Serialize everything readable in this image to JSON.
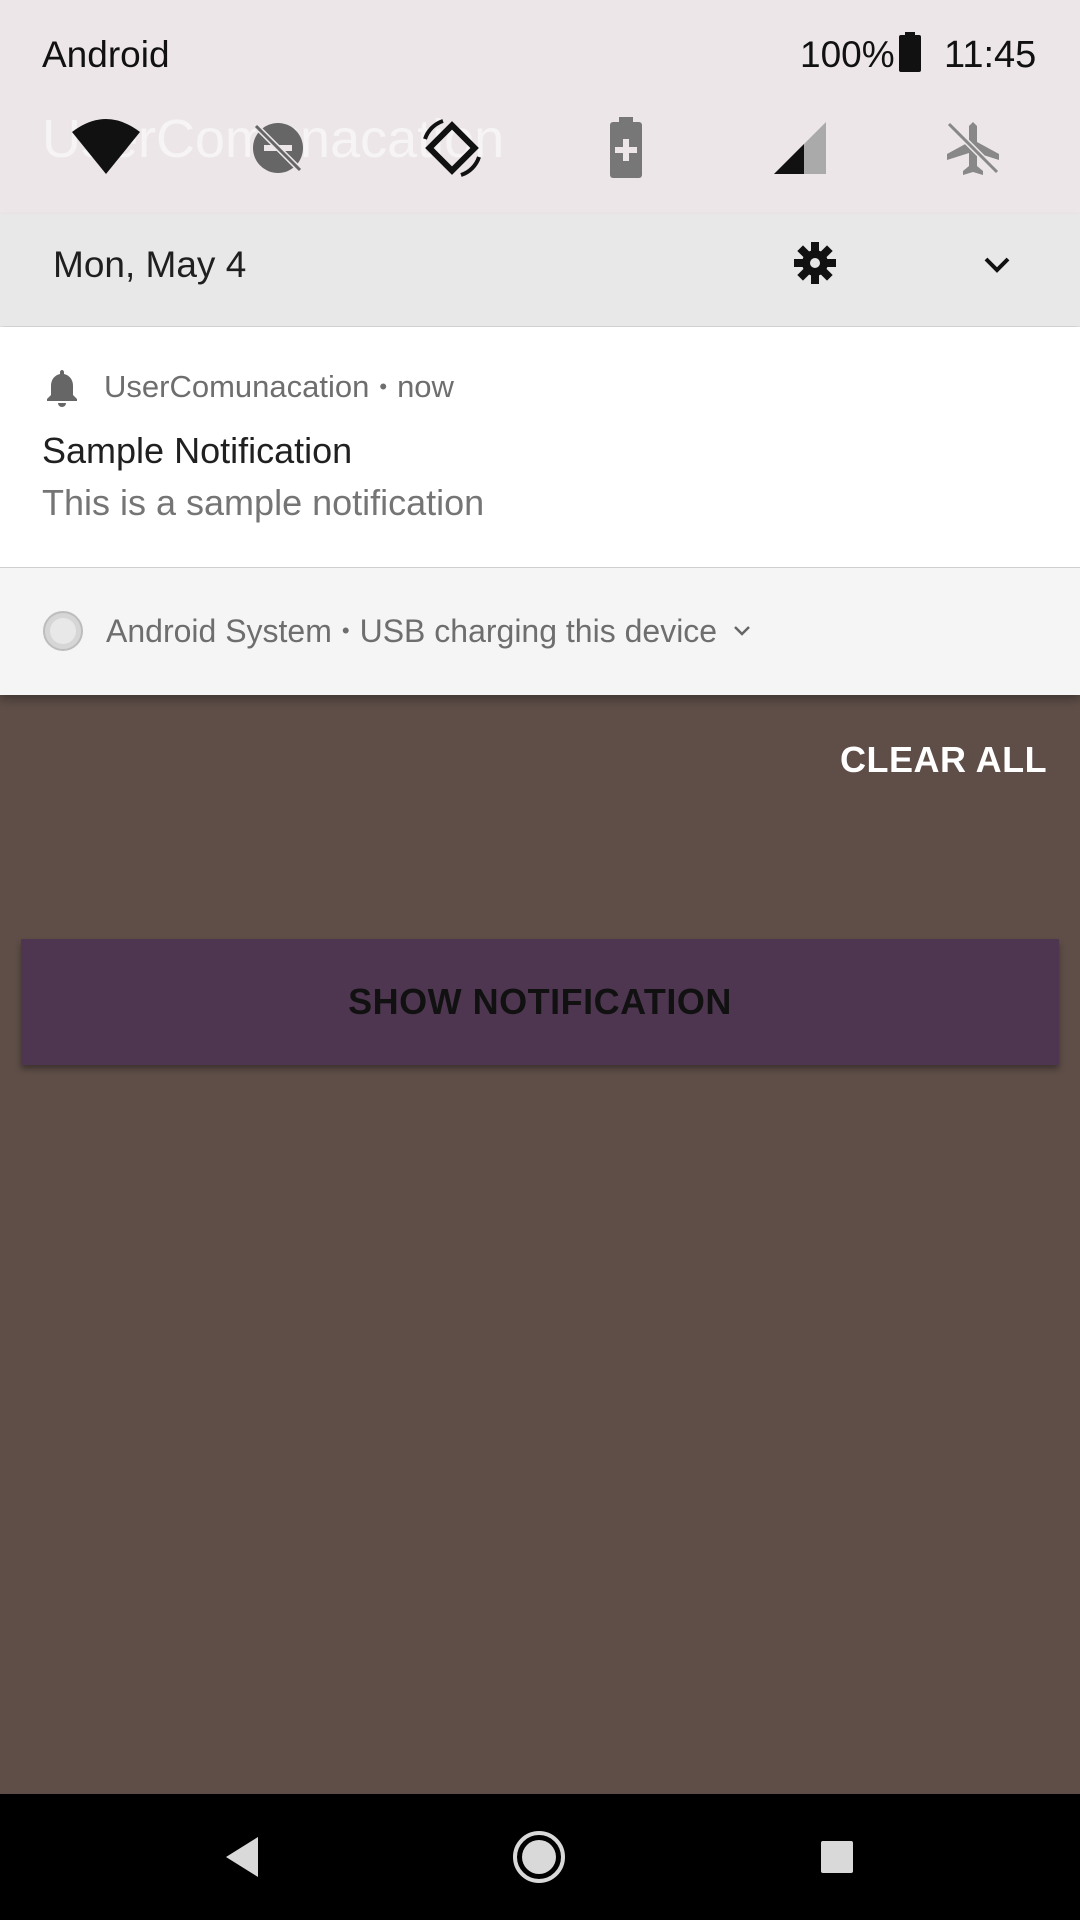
{
  "status_bar": {
    "carrier": "Android",
    "battery_percent": "100%",
    "time": "11:45"
  },
  "background_app_title": "UserComunacation",
  "quick_settings": {
    "tiles": [
      {
        "icon": "wifi-icon"
      },
      {
        "icon": "do-not-disturb-off-icon"
      },
      {
        "icon": "auto-rotate-icon"
      },
      {
        "icon": "battery-saver-icon"
      },
      {
        "icon": "cellular-signal-icon"
      },
      {
        "icon": "airplane-mode-off-icon"
      }
    ],
    "date": "Mon, May 4"
  },
  "notifications": [
    {
      "app": "UserComunacation",
      "time": "now",
      "title": "Sample Notification",
      "body": "This is a sample notification"
    }
  ],
  "system_notification": {
    "app": "Android System",
    "text": "USB charging this device"
  },
  "clear_all_label": "CLEAR ALL",
  "app": {
    "show_notification_label": "SHOW NOTIFICATION",
    "button_color": "#4e3651",
    "background_color": "#5f4e48"
  },
  "separator": "•"
}
